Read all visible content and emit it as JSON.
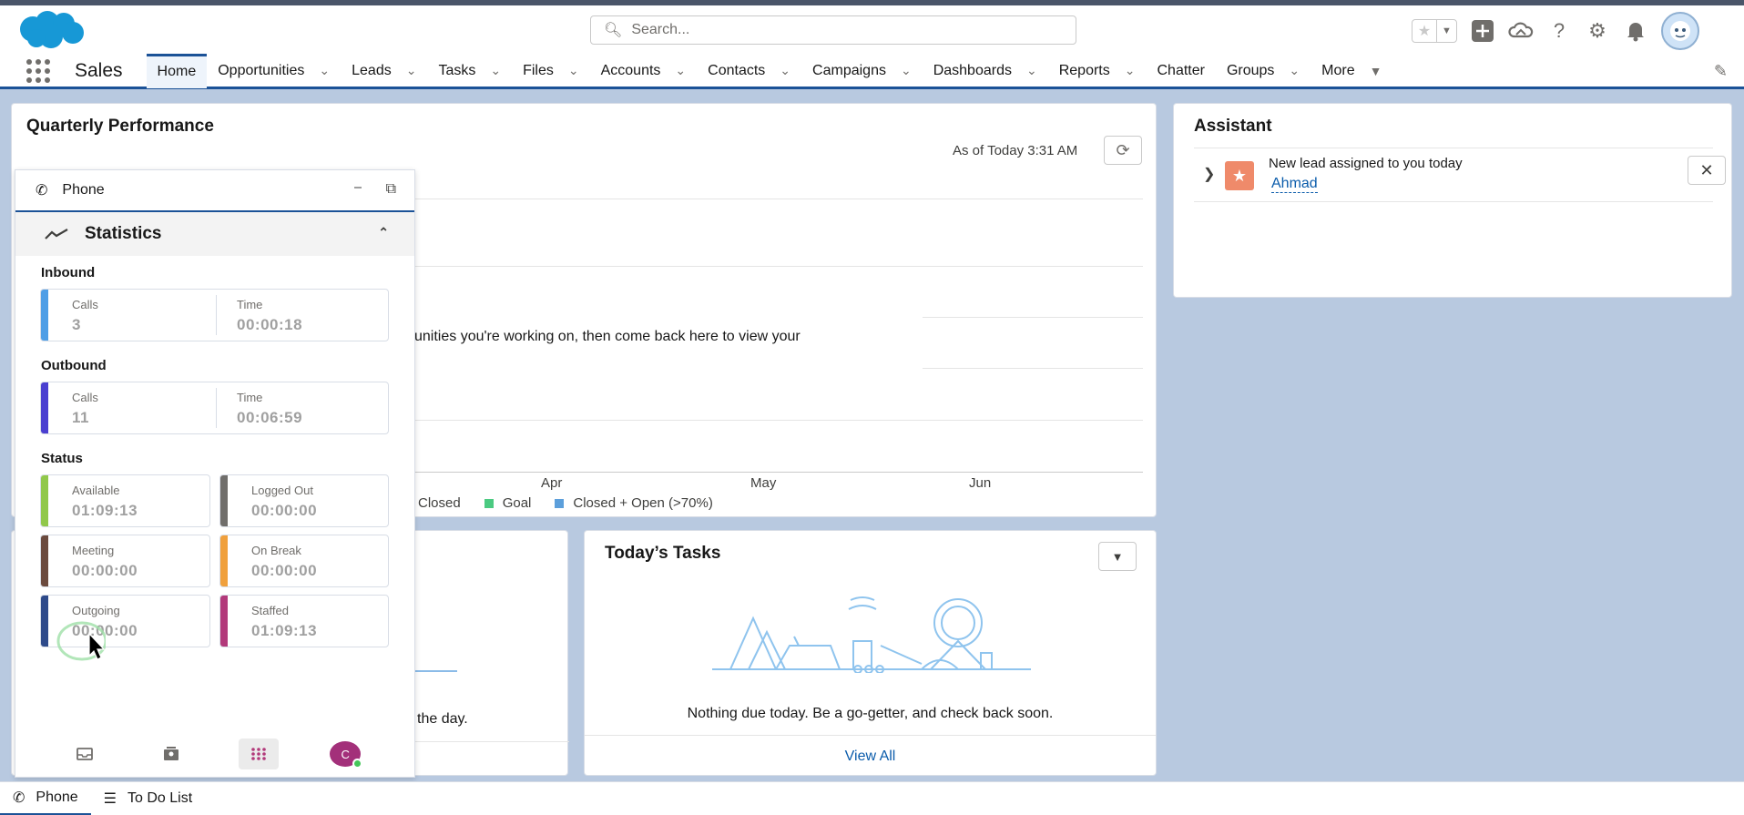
{
  "header": {
    "search_placeholder": "Search...",
    "icons": [
      "star-icon",
      "caret-down-icon",
      "plus-icon",
      "cloud-icon",
      "help-icon",
      "gear-icon",
      "bell-icon",
      "avatar"
    ]
  },
  "nav": {
    "app_name": "Sales",
    "items": [
      {
        "label": "Home"
      },
      {
        "label": "Opportunities"
      },
      {
        "label": "Leads"
      },
      {
        "label": "Tasks"
      },
      {
        "label": "Files"
      },
      {
        "label": "Accounts"
      },
      {
        "label": "Contacts"
      },
      {
        "label": "Campaigns"
      },
      {
        "label": "Dashboards"
      },
      {
        "label": "Reports"
      },
      {
        "label": "Chatter"
      },
      {
        "label": "Groups"
      },
      {
        "label": "More"
      }
    ]
  },
  "quarterly": {
    "title": "Quarterly Performance",
    "as_of": "As of Today 3:31 AM",
    "message": "unities you're working on, then come back here to view your",
    "months": [
      "Apr",
      "May",
      "Jun"
    ],
    "legend": [
      {
        "label": "Closed",
        "color": ""
      },
      {
        "label": "Goal",
        "color": "#4bca81"
      },
      {
        "label": "Closed + Open (>70%)",
        "color": "#5c9fdb"
      }
    ]
  },
  "assistant": {
    "title": "Assistant",
    "item_text": "New lead assigned to you today",
    "item_link": "Ahmad"
  },
  "left_card": {
    "message": "the day."
  },
  "tasks": {
    "title": "Today’s Tasks",
    "empty_message": "Nothing due today. Be a go-getter, and check back soon.",
    "view_all": "View All"
  },
  "phone": {
    "title": "Phone",
    "statistics_label": "Statistics",
    "inbound": {
      "label": "Inbound",
      "calls_label": "Calls",
      "calls": "3",
      "time_label": "Time",
      "time": "00:00:18"
    },
    "outbound": {
      "label": "Outbound",
      "calls_label": "Calls",
      "calls": "11",
      "time_label": "Time",
      "time": "00:06:59"
    },
    "status_label": "Status",
    "statuses": [
      {
        "label": "Available",
        "value": "01:09:13",
        "color": "#91c84a"
      },
      {
        "label": "Logged Out",
        "value": "00:00:00",
        "color": "#706e6b"
      },
      {
        "label": "Meeting",
        "value": "00:00:00",
        "color": "#6b4a3e"
      },
      {
        "label": "On Break",
        "value": "00:00:00",
        "color": "#f0a03c"
      },
      {
        "label": "Outgoing",
        "value": "00:00:00",
        "color": "#2e4a8a"
      },
      {
        "label": "Staffed",
        "value": "01:09:13",
        "color": "#b2397a"
      }
    ],
    "inbound_color": "#4f9ee6",
    "outbound_color": "#4a3fd0",
    "avatar_initial": "C"
  },
  "utility": {
    "items": [
      {
        "label": "Phone"
      },
      {
        "label": "To Do List"
      }
    ]
  }
}
